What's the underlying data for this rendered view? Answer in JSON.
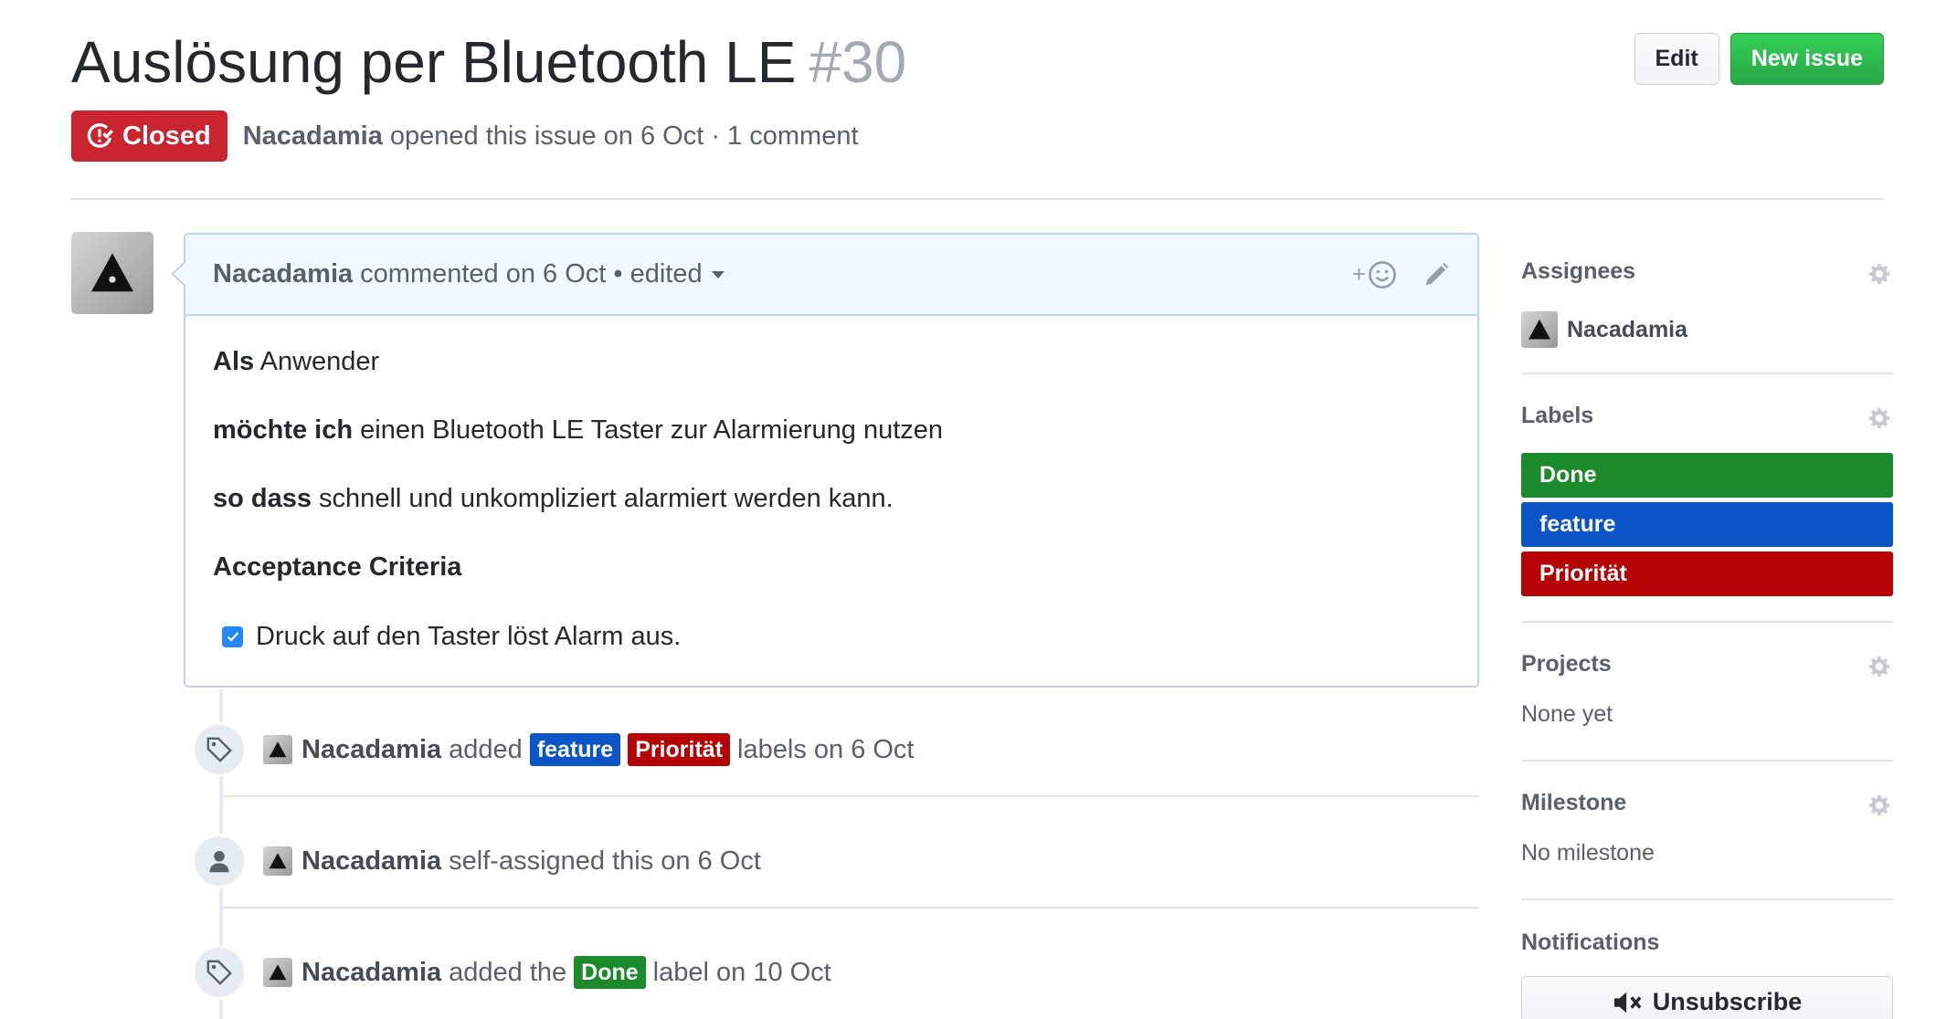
{
  "issue": {
    "title": "Auslösung per Bluetooth LE",
    "number": "#30",
    "state": "Closed",
    "author": "Nacadamia",
    "meta": "opened this issue on 6 Oct · 1 comment"
  },
  "header_buttons": {
    "edit": "Edit",
    "new_issue": "New issue"
  },
  "comment": {
    "author": "Nacadamia",
    "meta": "commented on 6 Oct • edited",
    "reaction": "+",
    "body": {
      "line1_bold": "Als",
      "line1_rest": " Anwender",
      "line2_bold": "möchte ich",
      "line2_rest": " einen Bluetooth LE Taster zur Alarmierung nutzen",
      "line3_bold": "so dass",
      "line3_rest": " schnell und unkompliziert alarmiert werden kann.",
      "heading": "Acceptance Criteria",
      "task": "Druck auf den Taster löst Alarm aus.",
      "task_checked": true
    }
  },
  "timeline": [
    {
      "icon": "tag-icon",
      "actor": "Nacadamia",
      "text1": "added",
      "labels": [
        "feature",
        "Priorität"
      ],
      "text2": "labels on 6 Oct"
    },
    {
      "icon": "person-icon",
      "actor": "Nacadamia",
      "text1": "self-assigned this on 6 Oct"
    },
    {
      "icon": "tag-icon",
      "actor": "Nacadamia",
      "text1": "added the",
      "labels": [
        "Done"
      ],
      "text2": "label on 10 Oct"
    }
  ],
  "sidebar": {
    "assignees": {
      "title": "Assignees",
      "user": "Nacadamia"
    },
    "labels": {
      "title": "Labels",
      "items": [
        {
          "name": "Done",
          "color": "#1b8a2b"
        },
        {
          "name": "feature",
          "color": "#0b55c8"
        },
        {
          "name": "Priorität",
          "color": "#b60205"
        }
      ]
    },
    "projects": {
      "title": "Projects",
      "value": "None yet"
    },
    "milestone": {
      "title": "Milestone",
      "value": "No milestone"
    },
    "notifications": {
      "title": "Notifications",
      "button": "Unsubscribe"
    }
  },
  "colors": {
    "closed": "#cb2431",
    "new_issue": "#28a745",
    "label_feature": "#0b55c8",
    "label_prio": "#b60205",
    "label_done": "#1b8a2b",
    "comment_header_bg": "#f1f8ff"
  }
}
